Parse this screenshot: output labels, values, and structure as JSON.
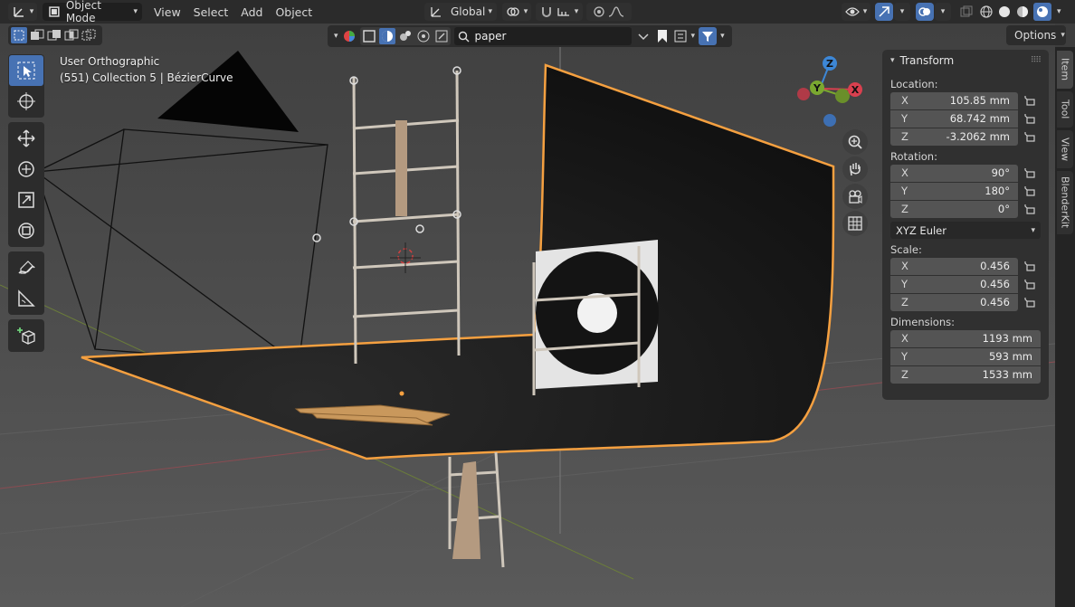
{
  "header": {
    "mode": "Object Mode",
    "menus": [
      "View",
      "Select",
      "Add",
      "Object"
    ],
    "transform_orientation": "Global"
  },
  "row2": {
    "search_value": "paper",
    "options_label": "Options"
  },
  "overlay": {
    "view_name": "User Orthographic",
    "context": "(551) Collection 5 | BézierCurve"
  },
  "gizmo": {
    "z_label": "Z",
    "y_label": "Y",
    "x_label": "X"
  },
  "panel": {
    "title": "Transform",
    "location_label": "Location:",
    "location": [
      {
        "axis": "X",
        "value": "105.85 mm"
      },
      {
        "axis": "Y",
        "value": "68.742 mm"
      },
      {
        "axis": "Z",
        "value": "-3.2062 mm"
      }
    ],
    "rotation_label": "Rotation:",
    "rotation": [
      {
        "axis": "X",
        "value": "90°"
      },
      {
        "axis": "Y",
        "value": "180°"
      },
      {
        "axis": "Z",
        "value": "0°"
      }
    ],
    "rotation_mode": "XYZ Euler",
    "scale_label": "Scale:",
    "scale": [
      {
        "axis": "X",
        "value": "0.456"
      },
      {
        "axis": "Y",
        "value": "0.456"
      },
      {
        "axis": "Z",
        "value": "0.456"
      }
    ],
    "dimensions_label": "Dimensions:",
    "dimensions": [
      {
        "axis": "X",
        "value": "1193 mm"
      },
      {
        "axis": "Y",
        "value": "593 mm"
      },
      {
        "axis": "Z",
        "value": "1533 mm"
      }
    ]
  },
  "tabs": [
    "Item",
    "Tool",
    "View",
    "BlenderKit"
  ],
  "colors": {
    "accent": "#4772b3",
    "selection_outline": "#f5a040",
    "axis_x": "#d9404f",
    "axis_y": "#7aa830",
    "axis_z": "#3d87d6"
  }
}
